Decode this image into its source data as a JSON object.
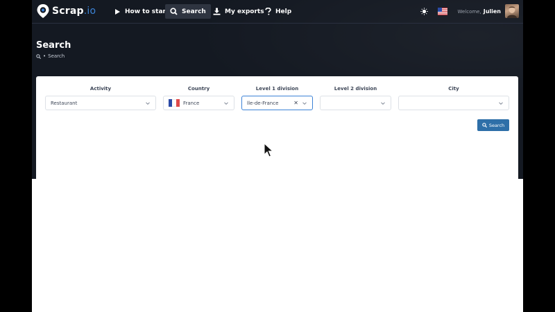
{
  "brand": {
    "name": "Scrap",
    "tld": ".io"
  },
  "nav": {
    "items": [
      {
        "label": "How to start",
        "icon": "play-icon"
      },
      {
        "label": "Search",
        "icon": "search-icon",
        "active": true
      },
      {
        "label": "My exports",
        "icon": "download-icon"
      },
      {
        "label": "Help",
        "icon": "question-icon"
      }
    ],
    "welcome_label": "Welcome,",
    "user_name": "Julien"
  },
  "header": {
    "title": "Search",
    "breadcrumb_sep": "•",
    "breadcrumb_current": "Search"
  },
  "filters": {
    "activity": {
      "label": "Activity",
      "value": "Restaurant"
    },
    "country": {
      "label": "Country",
      "value": "France"
    },
    "level1": {
      "label": "Level 1 division",
      "value": "Île-de-France"
    },
    "level2": {
      "label": "Level 2 division",
      "value": ""
    },
    "city": {
      "label": "City",
      "value": ""
    }
  },
  "search_button": {
    "label": "Search"
  },
  "colors": {
    "hero_bg": "#141922",
    "accent": "#3b82d6",
    "button": "#2e6fa8",
    "flag_fr": [
      "#2b4aa6",
      "#ffffff",
      "#e04a4a"
    ]
  }
}
